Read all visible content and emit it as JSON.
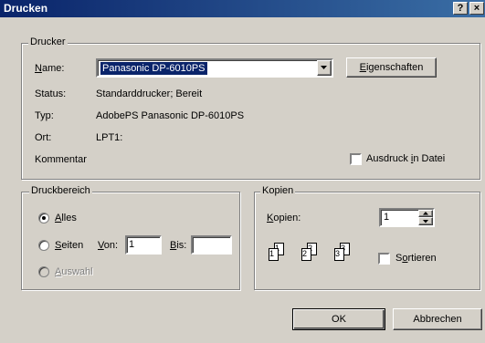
{
  "window": {
    "title": "Drucken"
  },
  "titlebar": {
    "help_label": "?",
    "close_label": "×"
  },
  "printer_group": {
    "legend": "Drucker",
    "name_label": "Name:",
    "name_value": "Panasonic DP-6010PS",
    "properties_button": "Eigenschaften",
    "status_label": "Status:",
    "status_value": "Standarddrucker; Bereit",
    "type_label": "Typ:",
    "type_value": "AdobePS Panasonic DP-6010PS",
    "location_label": "Ort:",
    "location_value": "LPT1:",
    "comment_label": "Kommentar",
    "print_to_file_label": "Ausdruck in Datei",
    "print_to_file_checked": false
  },
  "range_group": {
    "legend": "Druckbereich",
    "all_label": "Alles",
    "pages_label": "Seiten",
    "from_label": "Von:",
    "from_value": "1",
    "to_label": "Bis:",
    "to_value": "",
    "selection_label": "Auswahl",
    "selected": "all"
  },
  "copies_group": {
    "legend": "Kopien",
    "copies_label": "Kopien:",
    "copies_value": "1",
    "collate_label": "Sortieren",
    "collate_checked": false,
    "collate_pages": [
      "1",
      "1",
      "2",
      "2",
      "3",
      "3"
    ]
  },
  "buttons": {
    "ok": "OK",
    "cancel": "Abbrechen"
  }
}
